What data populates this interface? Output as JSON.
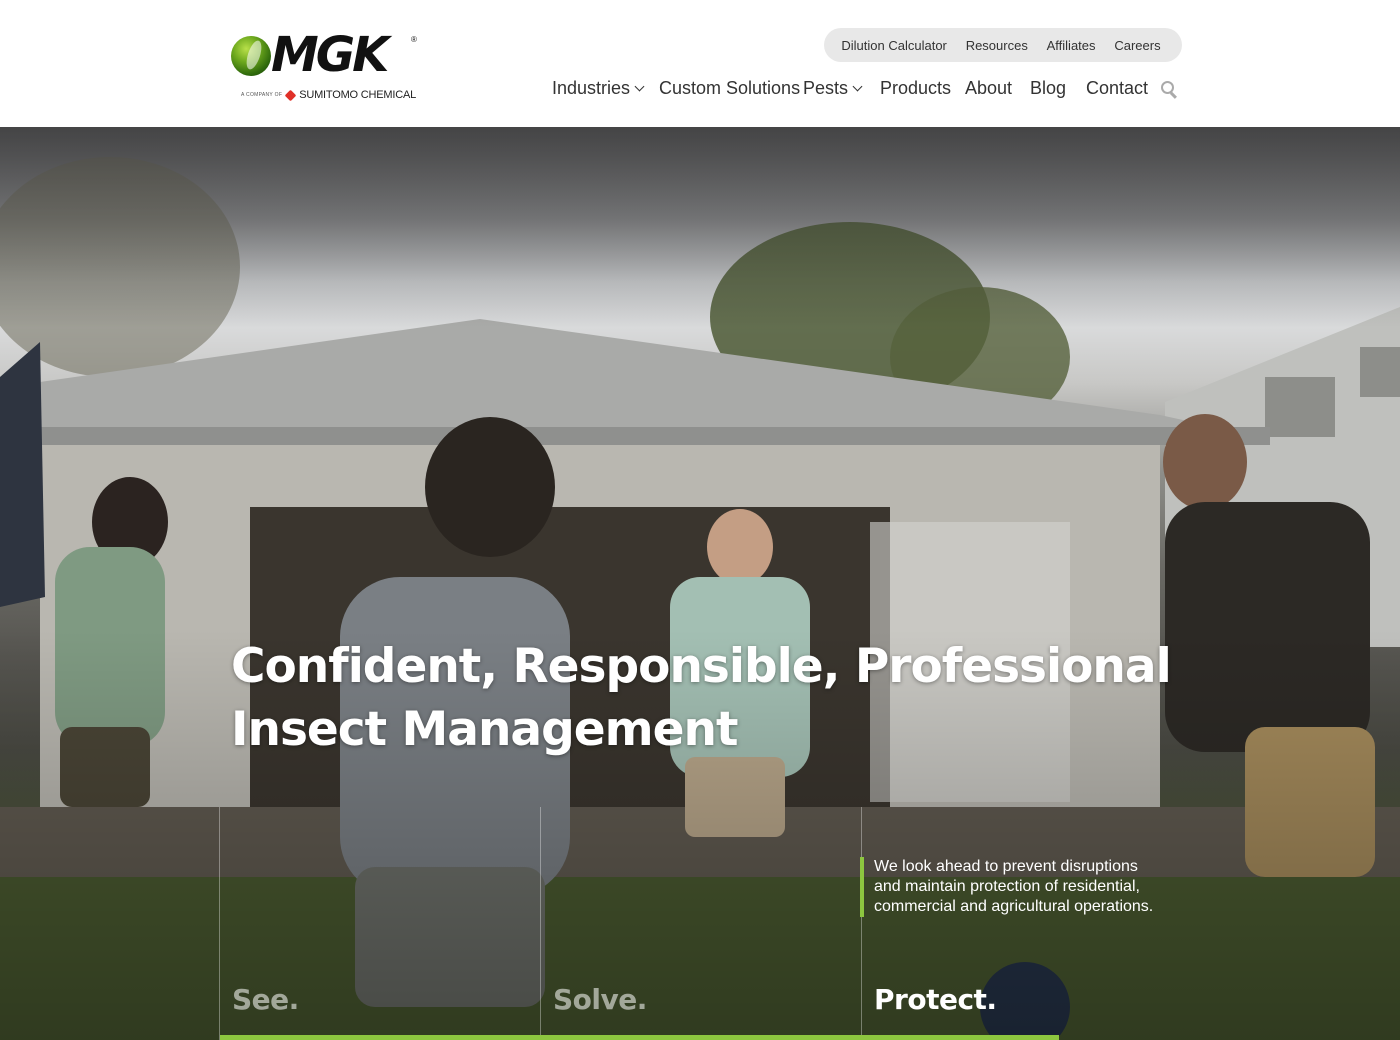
{
  "brand": {
    "name": "MGK",
    "registered": "®",
    "parent_prefix": "A COMPANY OF",
    "parent_company": "SUMITOMO CHEMICAL"
  },
  "utility_nav": [
    "Dilution Calculator",
    "Resources",
    "Affiliates",
    "Careers"
  ],
  "main_nav": [
    {
      "label": "Industries",
      "dropdown": true
    },
    {
      "label": "Custom Solutions",
      "dropdown": false
    },
    {
      "label": "Pests",
      "dropdown": true
    },
    {
      "label": "Products",
      "dropdown": false
    },
    {
      "label": "About",
      "dropdown": false
    },
    {
      "label": "Blog",
      "dropdown": false
    },
    {
      "label": "Contact",
      "dropdown": false
    }
  ],
  "hero": {
    "headline_line1": "Confident, Responsible, Professional",
    "headline_line2": "Insect Management",
    "tagline": "We look ahead to prevent disruptions and maintain protection of residential, commercial and agricultural operations.",
    "columns": [
      "See.",
      "Solve.",
      "Protect."
    ],
    "active_column": 2
  },
  "colors": {
    "accent_green": "#8dc63f",
    "utility_bg": "#e8e8e8",
    "text": "#333333"
  },
  "icons": {
    "search": "search-icon",
    "dropdown": "chevron-down-icon"
  }
}
